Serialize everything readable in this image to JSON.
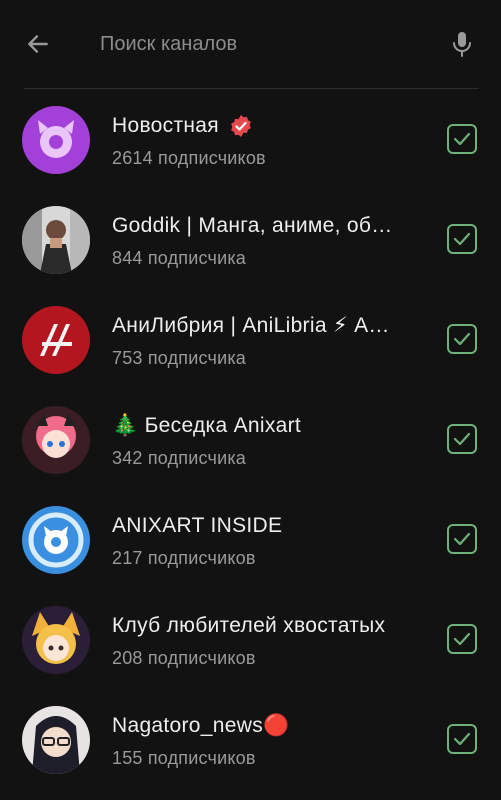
{
  "search": {
    "placeholder": "Поиск каналов",
    "value": ""
  },
  "channels": [
    {
      "title": "Новостная",
      "subtitle": "2614 подписчиков",
      "verified": true,
      "checked": true
    },
    {
      "title": "Goddik | Манга, аниме, об…",
      "subtitle": "844 подписчика",
      "checked": true
    },
    {
      "title": "АниЛибрия | AniLibria ⚡ А…",
      "subtitle": "753 подписчика",
      "checked": true
    },
    {
      "title": "Беседка Anixart",
      "title_prefix": "🎄",
      "subtitle": "342 подписчика",
      "checked": true
    },
    {
      "title": "ANIXART INSIDE",
      "subtitle": "217 подписчиков",
      "checked": true
    },
    {
      "title": "Клуб любителей хвостатых",
      "subtitle": "208 подписчиков",
      "checked": true
    },
    {
      "title": "Nagatoro_news",
      "title_suffix": "🔴",
      "subtitle": "155 подписчиков",
      "checked": true
    }
  ],
  "colors": {
    "background": "#121212",
    "check": "#6fb07b",
    "verified_badge": "#e5484d"
  },
  "icons": {
    "back": "arrow-left-icon",
    "mic": "microphone-icon",
    "check": "checkbox-checked-icon"
  }
}
